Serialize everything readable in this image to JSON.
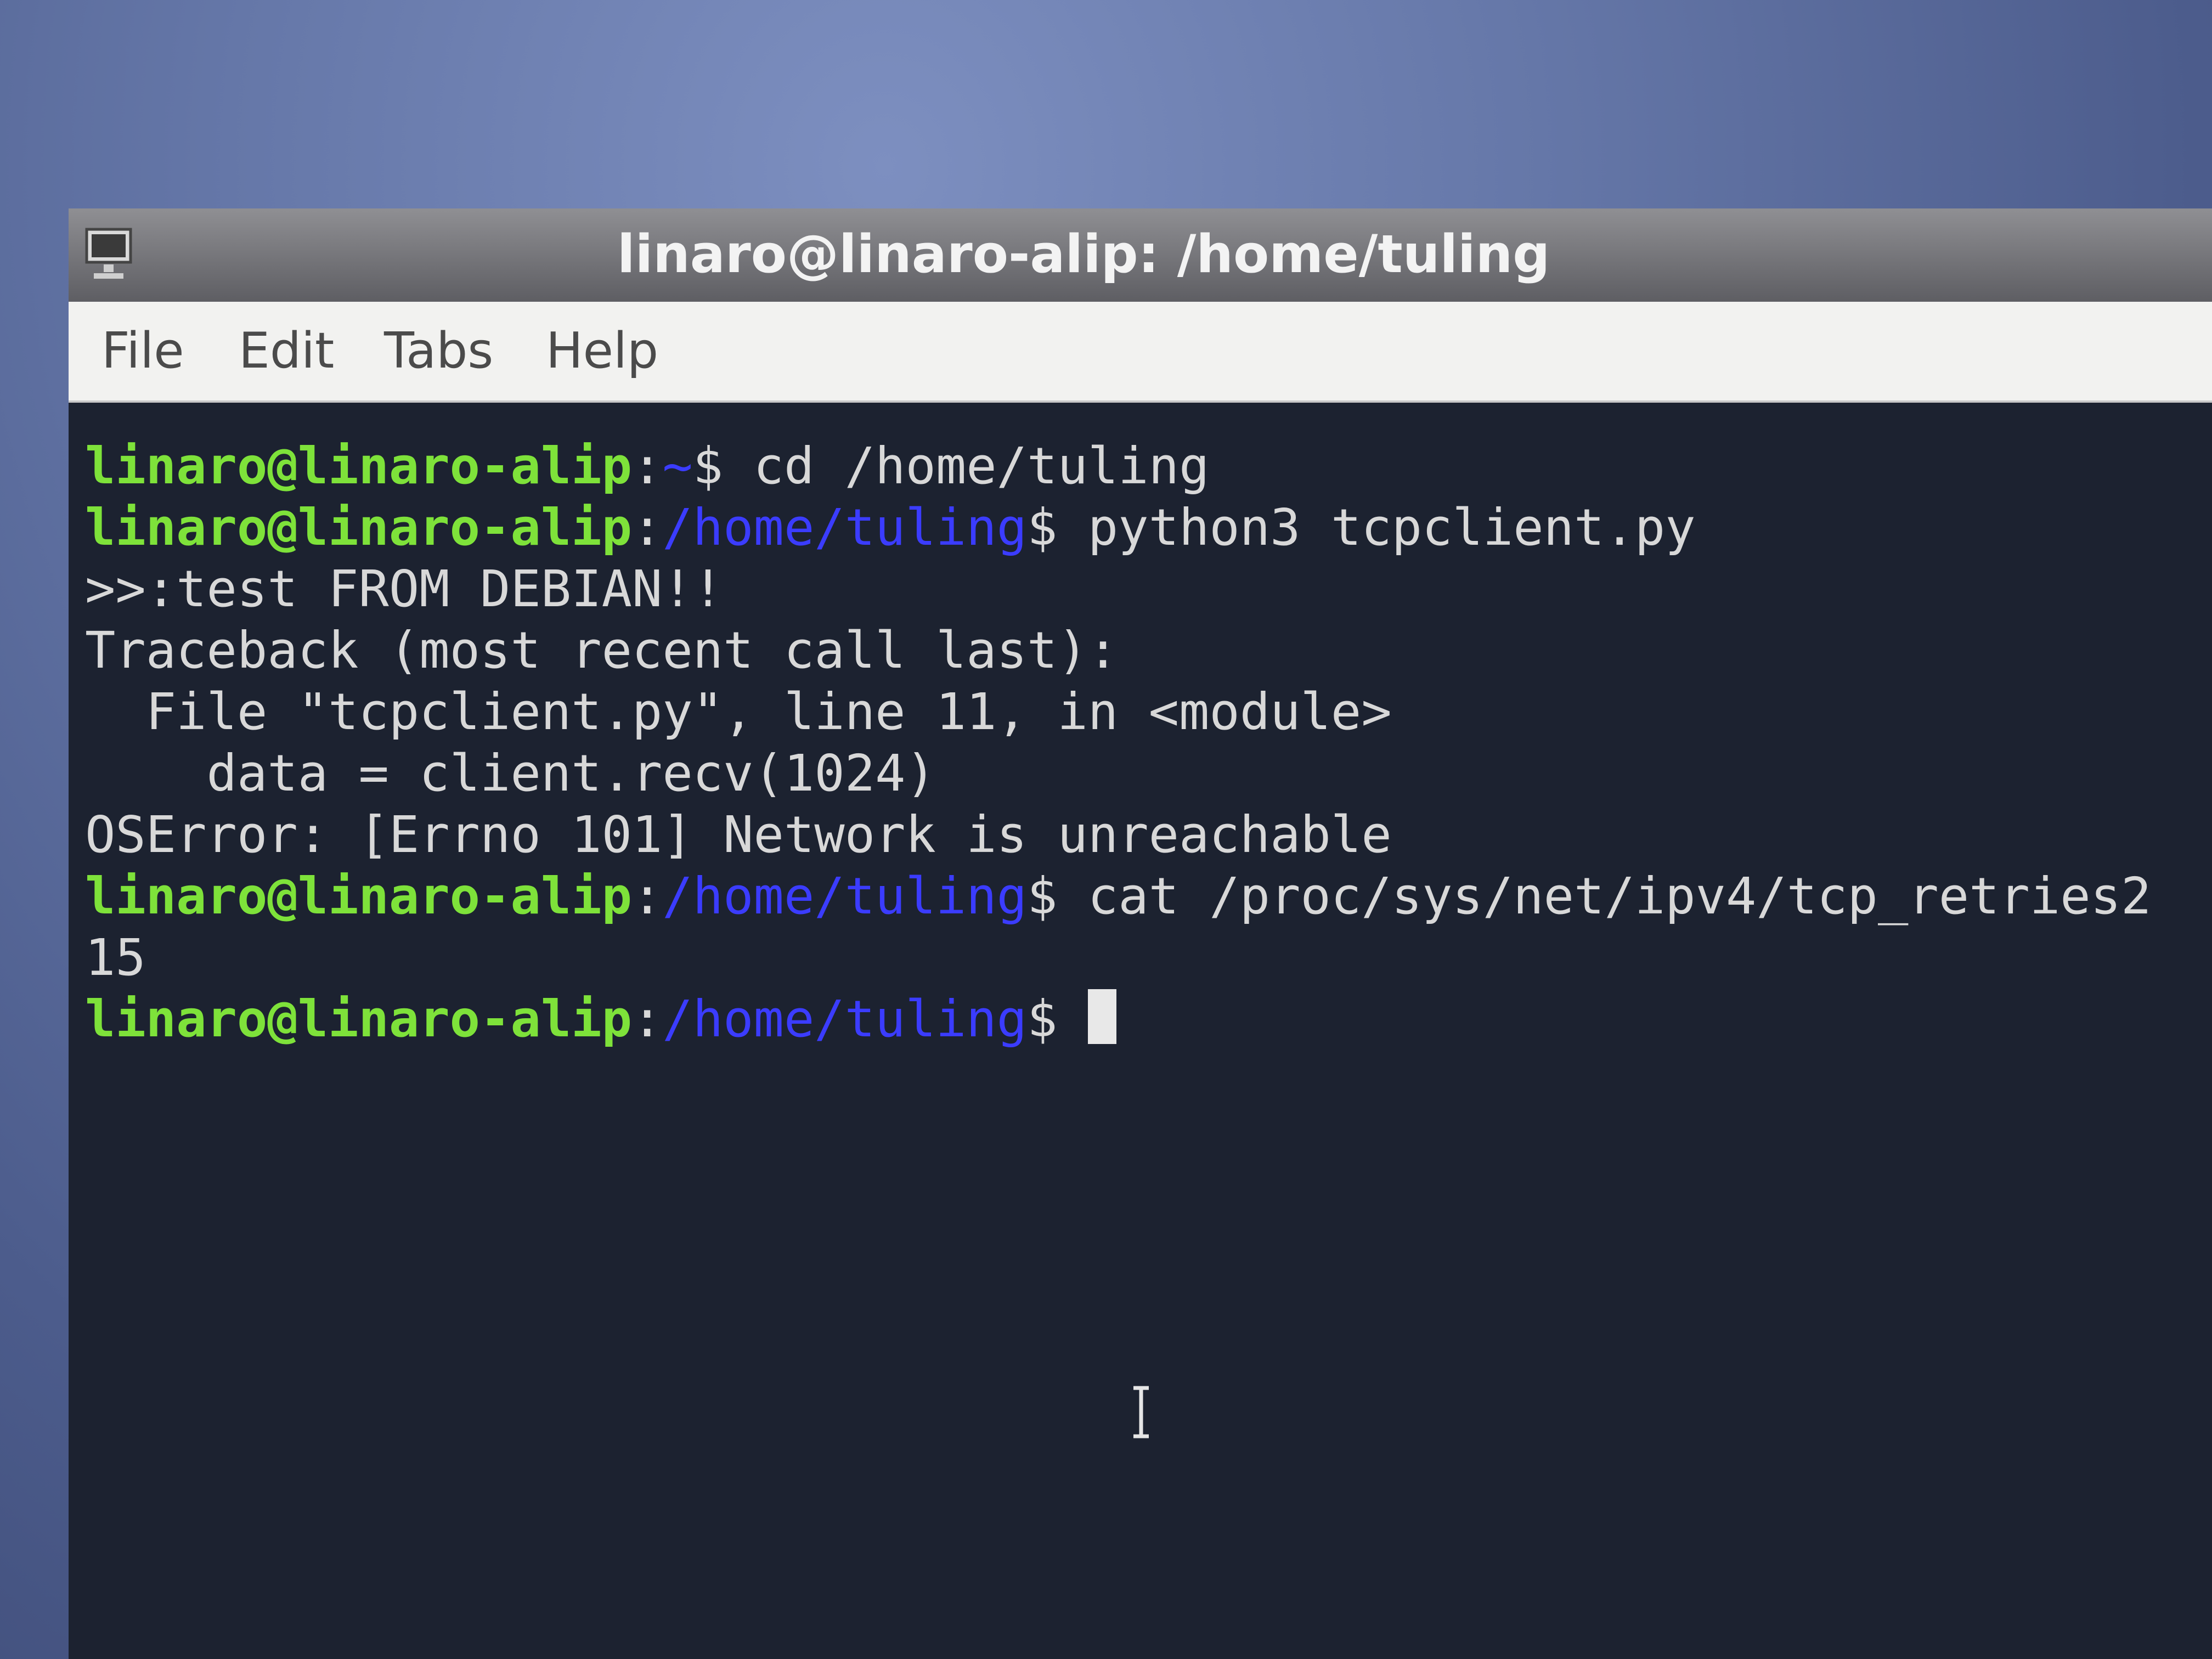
{
  "window": {
    "title": "linaro@linaro-alip: /home/tuling"
  },
  "menu": {
    "items": [
      "File",
      "Edit",
      "Tabs",
      "Help"
    ]
  },
  "terminal": {
    "lines": [
      {
        "user": "linaro@linaro-alip",
        "sep": ":",
        "path": "~",
        "cmd": "$ cd /home/tuling"
      },
      {
        "user": "linaro@linaro-alip",
        "sep": ":",
        "path": "/home/tuling",
        "cmd": "$ python3 tcpclient.py"
      },
      {
        "text": ">>:test FROM DEBIAN!!"
      },
      {
        "text": "Traceback (most recent call last):"
      },
      {
        "text": "  File \"tcpclient.py\", line 11, in <module>"
      },
      {
        "text": "    data = client.recv(1024)"
      },
      {
        "text": "OSError: [Errno 101] Network is unreachable"
      },
      {
        "user": "linaro@linaro-alip",
        "sep": ":",
        "path": "/home/tuling",
        "cmd": "$ cat /proc/sys/net/ipv4/tcp_retries2"
      },
      {
        "text": "15"
      },
      {
        "user": "linaro@linaro-alip",
        "sep": ":",
        "path": "/home/tuling",
        "cmd": "$ "
      }
    ]
  },
  "colors": {
    "prompt_user": "#7ee23a",
    "prompt_path": "#3b3cff",
    "terminal_bg": "#1c2230",
    "terminal_text": "#d8d8d8"
  },
  "icons": {
    "app": "terminal-app-icon",
    "pointer": "text-ibeam-cursor-icon"
  }
}
